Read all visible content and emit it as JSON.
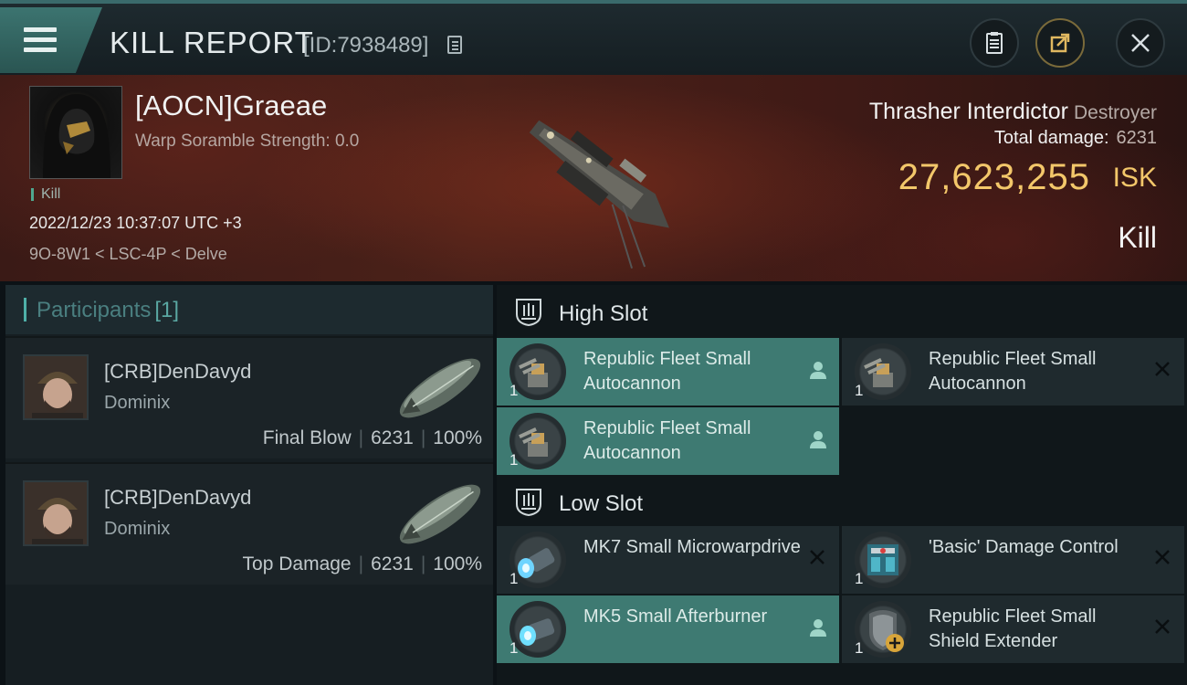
{
  "header": {
    "title": "KILL REPORT",
    "report_id": "[ID:7938489]"
  },
  "victim": {
    "name": "[AOCN]Graeae",
    "warp_scramble": "Warp Soramble Strength: 0.0",
    "tag": "Kill",
    "datetime": "2022/12/23 10:37:07 UTC +3",
    "location": "9O-8W1 < LSC-4P < Delve",
    "ship_name": "Thrasher Interdictor",
    "ship_class": "Destroyer",
    "total_damage_label": "Total damage:",
    "total_damage_value": "6231",
    "isk_value": "27,623,255",
    "isk_unit": "ISK",
    "result": "Kill"
  },
  "participants": {
    "title": "Participants",
    "count": "[1]",
    "items": [
      {
        "name": "[CRB]DenDavyd",
        "ship": "Dominix",
        "role": "Final Blow",
        "damage": "6231",
        "percent": "100%"
      },
      {
        "name": "[CRB]DenDavyd",
        "ship": "Dominix",
        "role": "Top Damage",
        "damage": "6231",
        "percent": "100%"
      }
    ]
  },
  "slots": {
    "high": {
      "label": "High Slot",
      "modules": [
        {
          "name": "Republic Fleet Small Autocannon",
          "qty": "1",
          "icon": "autocannon-icon",
          "state": "fitted"
        },
        {
          "name": "Republic Fleet Small Autocannon",
          "qty": "1",
          "icon": "autocannon-icon",
          "state": "destroyed"
        },
        {
          "name": "Republic Fleet Small Autocannon",
          "qty": "1",
          "icon": "autocannon-icon",
          "state": "fitted"
        }
      ]
    },
    "low": {
      "label": "Low Slot",
      "modules": [
        {
          "name": "MK7 Small Microwarpdrive",
          "qty": "1",
          "icon": "microwarpdrive-icon",
          "state": "destroyed"
        },
        {
          "name": "'Basic' Damage Control",
          "qty": "1",
          "icon": "damage-control-icon",
          "state": "destroyed"
        },
        {
          "name": "MK5 Small Afterburner",
          "qty": "1",
          "icon": "afterburner-icon",
          "state": "fitted"
        },
        {
          "name": "Republic Fleet Small Shield Extender",
          "qty": "1",
          "icon": "shield-extender-icon",
          "state": "destroyed"
        }
      ]
    }
  },
  "colors": {
    "accent": "#3e7a72",
    "isk": "#f3c76a",
    "banner": "#4b2119"
  }
}
